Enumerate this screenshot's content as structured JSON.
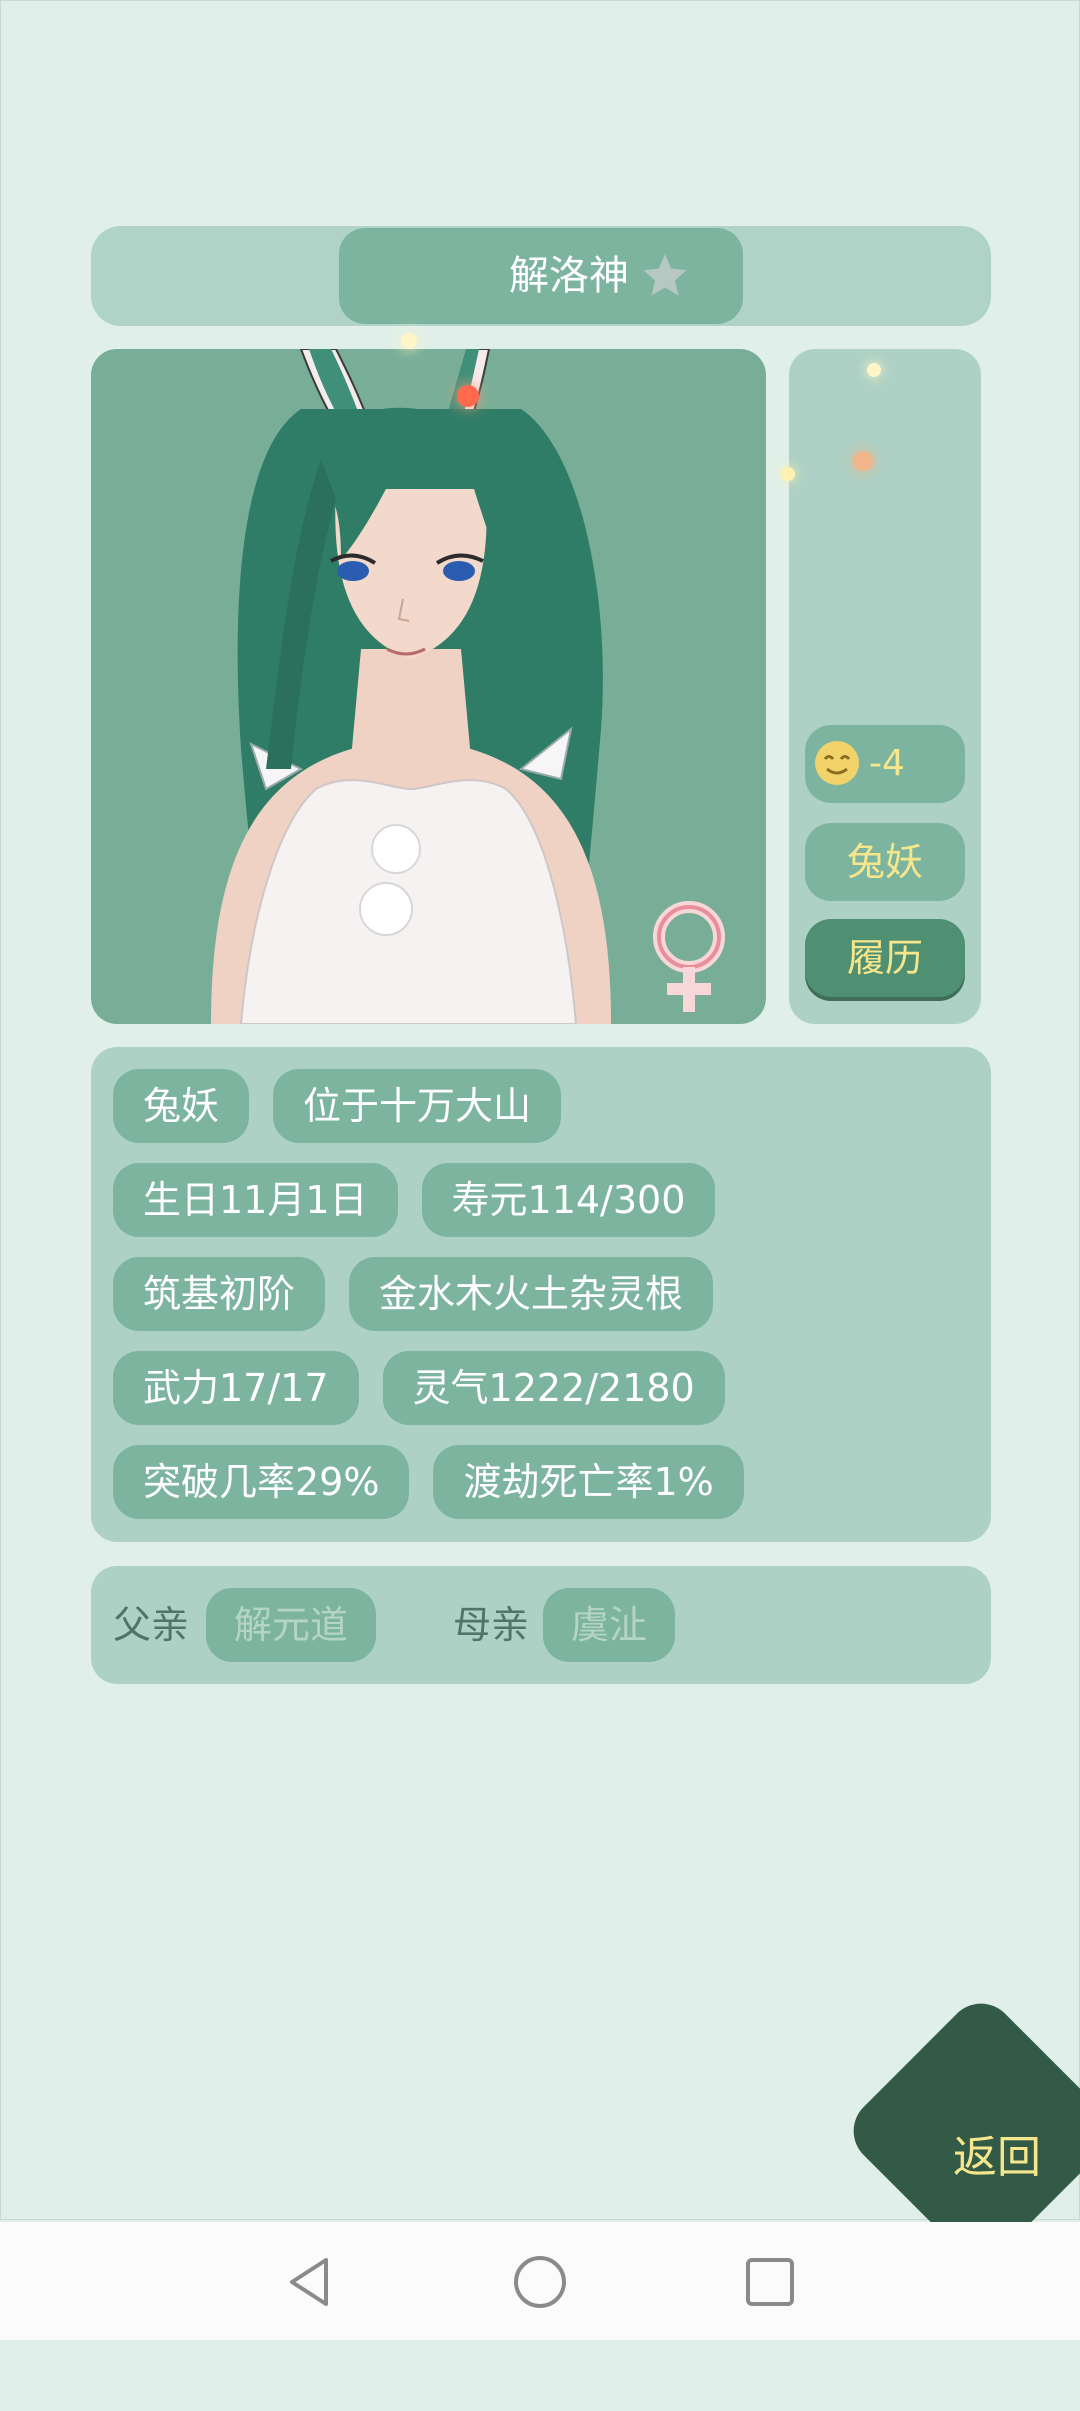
{
  "character": {
    "name": "解洛神",
    "mood_value": "-4",
    "race_button": "兔妖",
    "resume_button": "履历"
  },
  "info_tags": [
    [
      "兔妖",
      "位于十万大山"
    ],
    [
      "生日11月1日",
      "寿元114/300"
    ],
    [
      "筑基初阶",
      "金水木火土杂灵根"
    ],
    [
      "武力17/17",
      "灵气1222/2180"
    ],
    [
      "突破几率29%",
      "渡劫死亡率1%"
    ]
  ],
  "parents": {
    "father_label": "父亲",
    "father_name": "解元道",
    "mother_label": "母亲",
    "mother_name": "虞沚"
  },
  "return_button": "返回",
  "colors": {
    "background": "#e0efe9",
    "panel": "#aed1c5",
    "tag": "#7db49f",
    "accent_text": "#f6e68c",
    "return_bg": "#325a47"
  },
  "icons": [
    "star-icon",
    "female-symbol-icon",
    "smile-face-icon",
    "back-nav-icon",
    "home-nav-icon",
    "recents-nav-icon"
  ]
}
